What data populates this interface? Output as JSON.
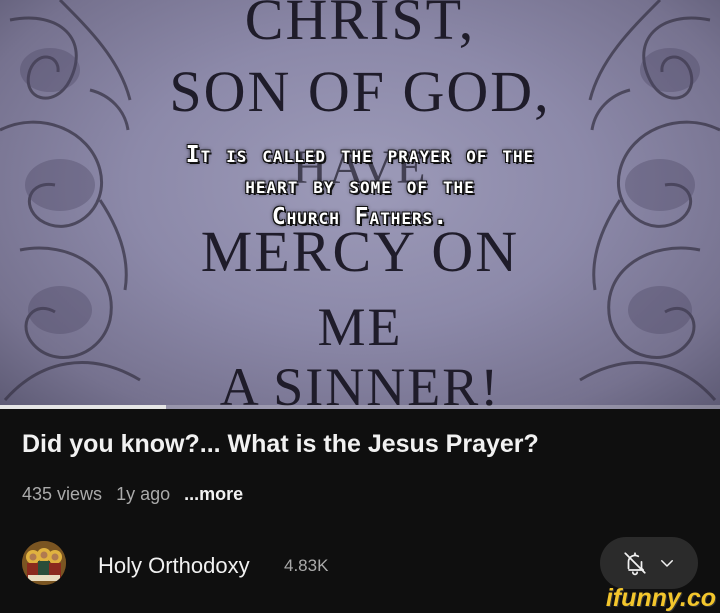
{
  "video": {
    "plaque_lines": [
      "CHRIST,",
      "SON OF GOD,",
      "HAVE",
      "MERCY ON",
      "ME",
      "A SINNER!"
    ],
    "caption_lines": [
      "It is called the prayer of the",
      "heart by some of the",
      "Church Fathers."
    ],
    "progress_fraction": 0.23
  },
  "title": "Did you know?... What is the Jesus Prayer?",
  "meta": {
    "views": "435 views",
    "age": "1y ago",
    "more": "...more"
  },
  "channel": {
    "name": "Holy Orthodoxy",
    "subscribers": "4.83K",
    "avatar_icon": "icon-saints-avatar"
  },
  "subscribe_button": {
    "bell_icon": "bell-off-icon",
    "chevron_icon": "chevron-down-icon"
  },
  "watermark": "ifunny.co",
  "colors": {
    "background": "#0f0f0f",
    "text_primary": "#f1f1f1",
    "text_secondary": "#aaaaaa",
    "button_bg": "#2b2b2b",
    "watermark": "#f3c62c"
  }
}
